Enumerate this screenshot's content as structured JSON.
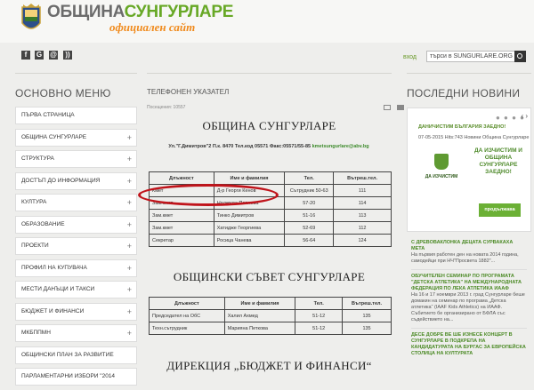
{
  "header": {
    "site_title_main": "ОБЩИНА",
    "site_title_accent": "СУНГУРЛАРЕ",
    "site_subtitle": "официален сайт"
  },
  "social": {
    "icons": [
      "facebook-icon",
      "google-icon",
      "at-icon",
      "rss-icon"
    ]
  },
  "topbar": {
    "login_label": "вход",
    "search_value": "търси в SUNGURLARE.ORG"
  },
  "sidebar": {
    "title": "ОСНОВНО МЕНЮ",
    "items": [
      {
        "label": "ПЪРВА СТРАНИЦА",
        "plus": ""
      },
      {
        "label": "ОБЩИНА СУНГУРЛАРЕ",
        "plus": "+"
      },
      {
        "label": "СТРУКТУРА",
        "plus": "+"
      },
      {
        "label": "ДОСТЪП ДО ИНФОРМАЦИЯ",
        "plus": "+"
      },
      {
        "label": "КУЛТУРА",
        "plus": "+"
      },
      {
        "label": "ОБРАЗОВАНИЕ",
        "plus": "+"
      },
      {
        "label": "ПРОЕКТИ",
        "plus": "+"
      },
      {
        "label": "ПРОФИЛ НА КУПУВАЧА",
        "plus": "+"
      },
      {
        "label": "МЕСТИ ДАНЪЦИ И ТАКСИ",
        "plus": "+"
      },
      {
        "label": "БЮДЖЕТ И ФИНАНСИ",
        "plus": "+"
      },
      {
        "label": "МКБППМН",
        "plus": "+"
      },
      {
        "label": "ОБЩИНСКИ ПЛАН ЗА РАЗВИТИЕ",
        "plus": ""
      },
      {
        "label": "ПАРЛАМЕНТАРНИ ИЗБОРИ \"2014",
        "plus": ""
      }
    ]
  },
  "main": {
    "page_title": "ТЕЛЕФОНЕН УКАЗАТЕЛ",
    "views": "Посещения: 10557",
    "section1_title": "ОБЩИНА СУНГУРЛАРЕ",
    "address": "Ул.\"Г.Димитров\"2 П.к. 8470  Тел.код  05571 Факс:05571/55-85",
    "email": "kmetsungurlare@abv.bg",
    "table_headers": [
      "Длъжност",
      "Име и фамилия",
      "Тел.",
      "Вътреш.тел."
    ],
    "table1_rows": [
      [
        "Кмет",
        "Д-р Георги Кенов",
        "Сътрудник 50-63",
        "111"
      ],
      [
        "Зам.кмет",
        "Надежда Павлева",
        "57-20",
        "114"
      ],
      [
        "Зам.кмет",
        "Тинко Димитров",
        "51-16",
        "113"
      ],
      [
        "Зам.кмет",
        "Хатидже Георгиева",
        "52-69",
        "112"
      ],
      [
        "Секретар",
        "Росица Чанева",
        "56-64",
        "124"
      ]
    ],
    "section2_title": "ОБЩИНСКИ СЪВЕТ СУНГУРЛАРЕ",
    "table2_rows": [
      [
        "Председател на ОбС",
        "Халил Ахмед",
        "51-12",
        "135"
      ],
      [
        "Техн.сътрудник",
        "Марияна Петкова",
        "51-12",
        "135"
      ]
    ],
    "section3_title": "ДИРЕКЦИЯ „БЮДЖЕТ И ФИНАНСИ“"
  },
  "news": {
    "title": "ПОСЛЕДНИ НОВИНИ",
    "featured_headline": "ДАНИЧИСТИМ БЪЛГАРИЯ ЗАЕДНО!",
    "featured_meta": "07-05-2015 Hits:743 Новини Община Сунгурларе",
    "badge_caption": "ДА ИЗЧИСТИМ",
    "promo_text": "ДА ИЗЧИСТИМ И ОБЩИНА СУНГУРЛАРЕ ЗАЕДНО!",
    "more_button": "продължава",
    "items": [
      {
        "title": "С ДРЕВОВАКЛОНКА ДЕЦАТА СУРВАКАХА МЕТА",
        "body": "На първия работен ден на новата 2014 година, самодейци при НЧ\"Просвета 1882\"..."
      },
      {
        "title": "ОБУЧИТЕЛЕН СЕМИНАР ПО ПРОГРАМАТА \"ДЕТСКА АТЛЕТИКА\" НА МЕЖДУНАРОДНАТА ФЕДЕРАЦИЯ ПО ЛЕКА АТЛЕТИКА ИААФ",
        "body": "На 16 и 17 ноември 2013 г. град Сунгурларе беше домакин на семинар по програма „Детска атлетика“ (IAAF Kids Athletics) на ИААФ. Събитието бе организирано от БФЛА със съдействието на..."
      },
      {
        "title": "ДЕСЕ ДОБРЕ ВЕ ШЕ ИЗНЕСЕ КОНЦЕРТ В СУНГУРЛАРЕ В ПОДКРЕПА НА КАНДИДАТУРАТА НА БУРГАС ЗА ЕВРОПЕЙСКА СТОЛИЦА НА КУЛТУРАТА",
        "body": ""
      }
    ]
  }
}
